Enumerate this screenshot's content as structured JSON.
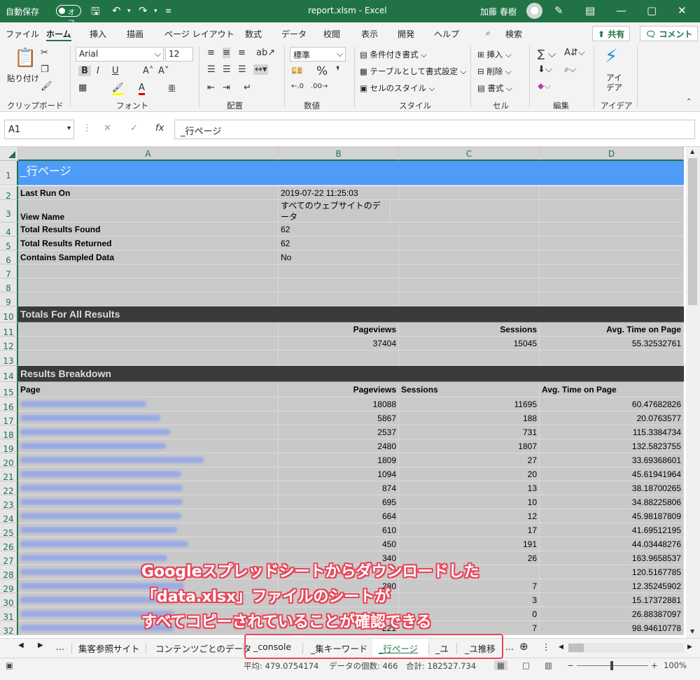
{
  "titlebar": {
    "autosave_label": "自動保存",
    "autosave_state": "オフ",
    "filename": "report.xlsm",
    "app": "Excel",
    "user": "加藤 春樹"
  },
  "menu": {
    "items": [
      "ファイル",
      "ホーム",
      "挿入",
      "描画",
      "ページ レイアウト",
      "数式",
      "データ",
      "校閲",
      "表示",
      "開発",
      "ヘルプ"
    ],
    "search": "検索",
    "share": "共有",
    "comment": "コメント"
  },
  "ribbon": {
    "paste": "貼り付け",
    "font_name": "Arial",
    "font_size": "12",
    "number_format": "標準",
    "cond_format": "条件付き書式",
    "table_format": "テーブルとして書式設定",
    "cell_style": "セルのスタイル",
    "insert": "挿入",
    "delete": "削除",
    "format": "書式",
    "ideas": "アイ\nデア",
    "groups": [
      "クリップボード",
      "フォント",
      "配置",
      "数値",
      "スタイル",
      "セル",
      "編集",
      "アイデア"
    ]
  },
  "formula_bar": {
    "namebox": "A1",
    "value": "_行ページ"
  },
  "columns": [
    "A",
    "B",
    "C",
    "D"
  ],
  "sheet": {
    "title": "_行ページ",
    "meta": [
      {
        "label": "Last Run On",
        "value": "2019-07-22 11:25:03"
      },
      {
        "label": "View Name",
        "value": "すべてのウェブサイトのデータ"
      },
      {
        "label": "Total Results Found",
        "value": "62"
      },
      {
        "label": "Total Results Returned",
        "value": "62"
      },
      {
        "label": "Contains Sampled Data",
        "value": "No"
      }
    ],
    "totals_header": "Totals For All Results",
    "totals_cols": [
      "Pageviews",
      "Sessions",
      "Avg. Time on Page"
    ],
    "totals_vals": [
      "37404",
      "15045",
      "55.32532761"
    ],
    "breakdown_header": "Results Breakdown",
    "breakdown_cols": [
      "Page",
      "Pageviews",
      "Sessions",
      "Avg. Time on Page"
    ],
    "rows": [
      {
        "pv": "18088",
        "s": "11695",
        "t": "60.47682826"
      },
      {
        "pv": "5867",
        "s": "188",
        "t": "20.0763577"
      },
      {
        "pv": "2537",
        "s": "731",
        "t": "115.3384734"
      },
      {
        "pv": "2480",
        "s": "1807",
        "t": "132.5823755"
      },
      {
        "pv": "1809",
        "s": "27",
        "t": "33.69368601"
      },
      {
        "pv": "1094",
        "s": "20",
        "t": "45.61941964"
      },
      {
        "pv": "874",
        "s": "13",
        "t": "38.18700265"
      },
      {
        "pv": "695",
        "s": "10",
        "t": "34.88225806"
      },
      {
        "pv": "664",
        "s": "12",
        "t": "45.98187809"
      },
      {
        "pv": "610",
        "s": "17",
        "t": "41.69512195"
      },
      {
        "pv": "450",
        "s": "191",
        "t": "44.03448276"
      },
      {
        "pv": "340",
        "s": "26",
        "t": "163.9658537"
      },
      {
        "pv": "",
        "s": "",
        "t": "120.5167785"
      },
      {
        "pv": "280",
        "s": "7",
        "t": "12.35245902"
      },
      {
        "pv": "",
        "s": "3",
        "t": "15.17372881"
      },
      {
        "pv": "",
        "s": "0",
        "t": "26.88387097"
      },
      {
        "pv": "221",
        "s": "7",
        "t": "98.94610778"
      }
    ]
  },
  "tabs": [
    "集客参照サイト",
    "コンテンツごとのデータ",
    "_console",
    "_集キーワード",
    "_行ページ",
    "_ユ",
    "_ユ推移"
  ],
  "active_tab": "_行ページ",
  "status": {
    "average": "平均: 479.0754174",
    "count": "データの個数: 466",
    "sum": "合計: 182527.734",
    "zoom": "100%"
  },
  "callout": {
    "line1": "Googleスプレッドシートからダウンロードした",
    "line2": "「data.xlsx」ファイルのシートが",
    "line3": "すべてコピーされていることが確認できる"
  }
}
